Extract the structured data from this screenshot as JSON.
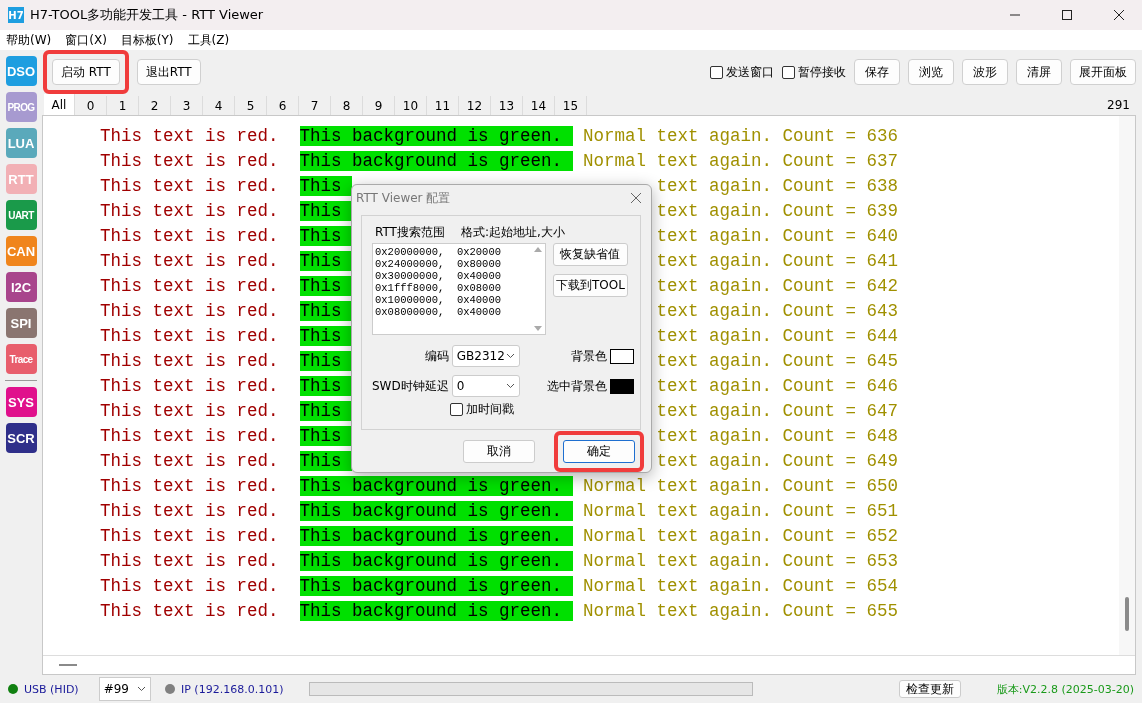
{
  "window": {
    "title": "H7-TOOL多功能开发工具 - RTT Viewer",
    "logo": "H7"
  },
  "menu": [
    "帮助(W)",
    "窗口(X)",
    "目标板(Y)",
    "工具(Z)"
  ],
  "sidebar": [
    {
      "label": "DSO",
      "color": "#1e9ee0"
    },
    {
      "label": "PROG",
      "color": "#a79ad0"
    },
    {
      "label": "LUA",
      "color": "#5aa9bb"
    },
    {
      "label": "RTT",
      "color": "#f2b0b5"
    },
    {
      "label": "UART",
      "color": "#1a9a4a"
    },
    {
      "label": "CAN",
      "color": "#f0851c"
    },
    {
      "label": "I2C",
      "color": "#a8458c"
    },
    {
      "label": "SPI",
      "color": "#8a7570"
    },
    {
      "label": "Trace",
      "color": "#e85e6c"
    },
    {
      "kind": "divider"
    },
    {
      "label": "SYS",
      "color": "#e0108c"
    },
    {
      "label": "SCR",
      "color": "#2f2f8a"
    }
  ],
  "toolbar": {
    "left_buttons": [
      {
        "label": "启动 RTT",
        "highlighted": true
      },
      {
        "label": "退出RTT",
        "highlighted": false
      }
    ],
    "checkboxes": [
      {
        "label": "发送窗口",
        "checked": false
      },
      {
        "label": "暂停接收",
        "checked": false
      }
    ],
    "right_buttons": [
      "保存",
      "浏览",
      "波形",
      "清屏",
      "展开面板"
    ]
  },
  "tabs": [
    {
      "label": "All",
      "selected": true
    },
    {
      "label": "0",
      "selected": false
    },
    {
      "label": "1",
      "selected": false
    },
    {
      "label": "2",
      "selected": false
    },
    {
      "label": "3",
      "selected": false
    },
    {
      "label": "4",
      "selected": false
    },
    {
      "label": "5",
      "selected": false
    },
    {
      "label": "6",
      "selected": false
    },
    {
      "label": "7",
      "selected": false
    },
    {
      "label": "8",
      "selected": false
    },
    {
      "label": "9",
      "selected": false
    },
    {
      "label": "10",
      "selected": false
    },
    {
      "label": "11",
      "selected": false
    },
    {
      "label": "12",
      "selected": false
    },
    {
      "label": "13",
      "selected": false
    },
    {
      "label": "14",
      "selected": false
    },
    {
      "label": "15",
      "selected": false
    }
  ],
  "line_count": "291",
  "terminal_lines": [
    {
      "red": "This text is red.",
      "green": "This background is green.",
      "normal": "Normal text again. Count = 636"
    },
    {
      "red": "This text is red.",
      "green": "This background is green.",
      "normal": "Normal text again. Count = 637"
    },
    {
      "red": "This text is red.",
      "green": "This",
      "normal": "text again. Count = 638"
    },
    {
      "red": "This text is red.",
      "green": "This",
      "normal": "text again. Count = 639"
    },
    {
      "red": "This text is red.",
      "green": "This",
      "normal": "text again. Count = 640"
    },
    {
      "red": "This text is red.",
      "green": "This",
      "normal": "text again. Count = 641"
    },
    {
      "red": "This text is red.",
      "green": "This",
      "normal": "text again. Count = 642"
    },
    {
      "red": "This text is red.",
      "green": "This",
      "normal": "text again. Count = 643"
    },
    {
      "red": "This text is red.",
      "green": "This",
      "normal": "text again. Count = 644"
    },
    {
      "red": "This text is red.",
      "green": "This",
      "normal": "text again. Count = 645"
    },
    {
      "red": "This text is red.",
      "green": "This",
      "normal": "text again. Count = 646"
    },
    {
      "red": "This text is red.",
      "green": "This",
      "normal": "text again. Count = 647"
    },
    {
      "red": "This text is red.",
      "green": "This",
      "normal": "text again. Count = 648"
    },
    {
      "red": "This text is red.",
      "green": "This",
      "normal": "text again. Count = 649"
    },
    {
      "red": "This text is red.",
      "green": "This background is green.",
      "normal": "Normal text again. Count = 650"
    },
    {
      "red": "This text is red.",
      "green": "This background is green.",
      "normal": "Normal text again. Count = 651"
    },
    {
      "red": "This text is red.",
      "green": "This background is green.",
      "normal": "Normal text again. Count = 652"
    },
    {
      "red": "This text is red.",
      "green": "This background is green.",
      "normal": "Normal text again. Count = 653"
    },
    {
      "red": "This text is red.",
      "green": "This background is green.",
      "normal": "Normal text again. Count = 654"
    },
    {
      "red": "This text is red.",
      "green": "This background is green.",
      "normal": "Normal text again. Count = 655"
    }
  ],
  "dialog": {
    "title": "RTT Viewer 配置",
    "range_label": "RTT搜索范围",
    "format_label": "格式:起始地址,大小",
    "ranges": [
      "0x20000000,  0x20000",
      "0x24000000,  0x80000",
      "0x30000000,  0x40000",
      "0x1fff8000,  0x08000",
      "0x10000000,  0x40000",
      "0x08000000,  0x40000"
    ],
    "side_buttons": [
      "恢复缺省值",
      "下载到TOOL"
    ],
    "encoding": {
      "label": "编码",
      "value": "GB2312"
    },
    "background": {
      "label": "背景色",
      "color": "#ffffff"
    },
    "swd_delay": {
      "label": "SWD时钟延迟",
      "value": "0"
    },
    "selected_background": {
      "label": "选中背景色",
      "color": "#000000"
    },
    "timestamp": {
      "label": "加时间戳",
      "checked": false
    },
    "buttons": [
      {
        "label": "取消",
        "highlighted": false,
        "default": false
      },
      {
        "label": "确定",
        "highlighted": true,
        "default": true
      }
    ]
  },
  "status_bar": {
    "usb": {
      "label": "USB (HID)",
      "connected": true
    },
    "device": "#99",
    "ip": {
      "label": "IP (192.168.0.101)",
      "connected": false
    },
    "progress": {
      "level": 0
    },
    "update_button": "检查更新",
    "version": "版本:V2.2.8 (2025-03-20)"
  }
}
